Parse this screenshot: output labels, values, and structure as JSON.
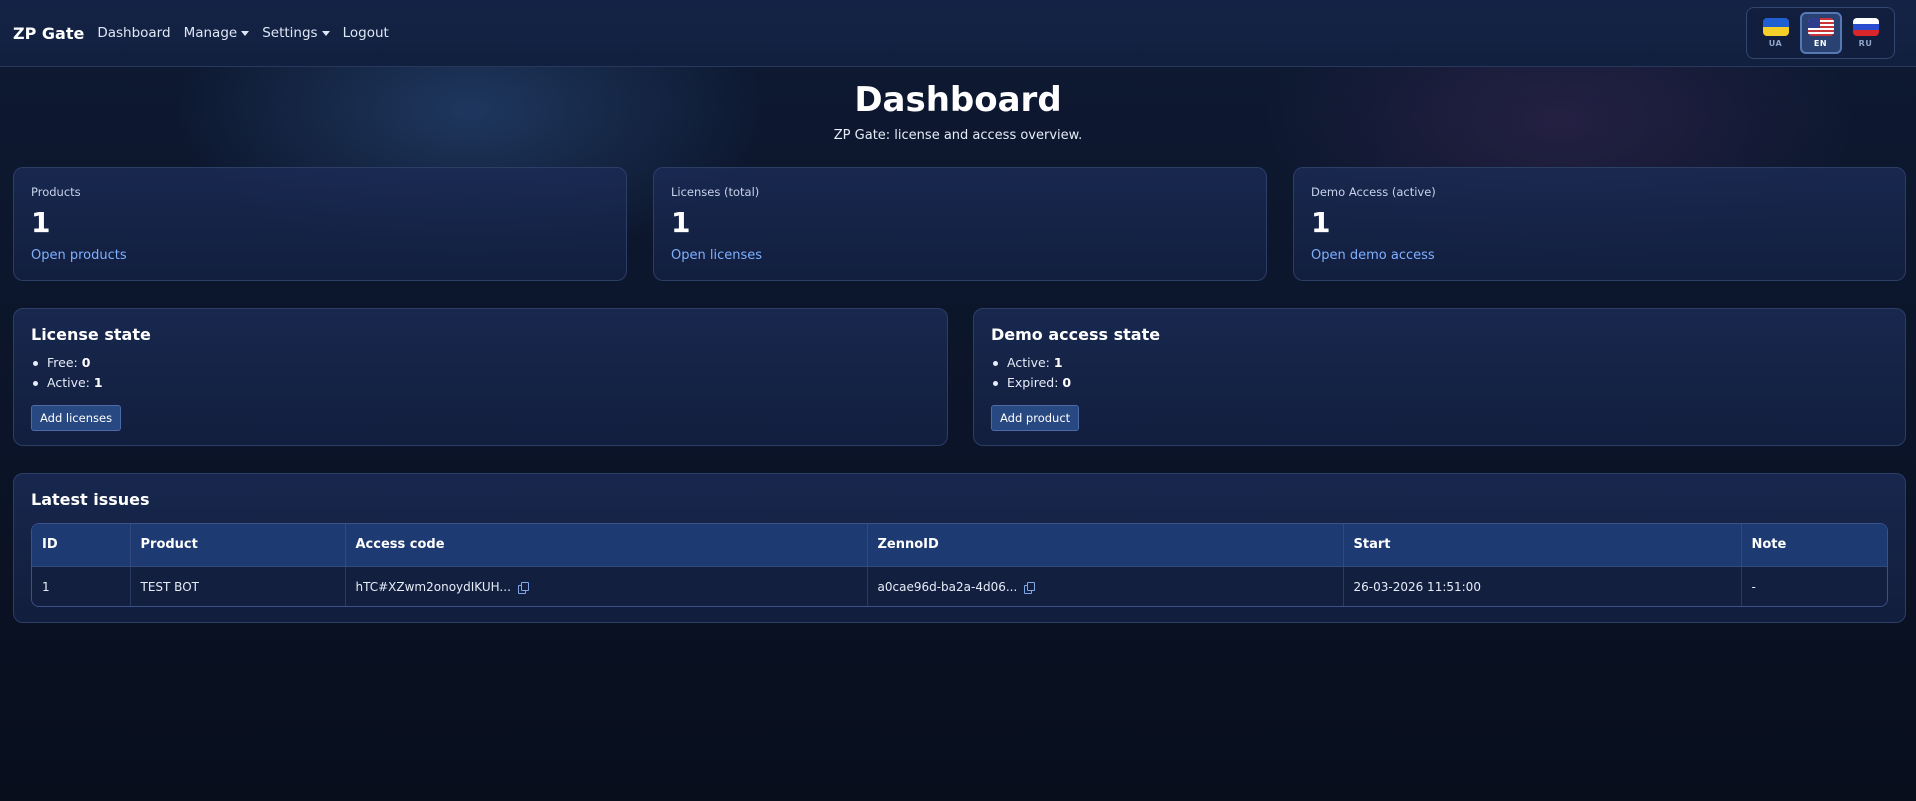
{
  "navbar": {
    "brand": "ZP Gate",
    "links": [
      {
        "label": "Dashboard"
      },
      {
        "label": "Manage"
      },
      {
        "label": "Settings"
      },
      {
        "label": "Logout"
      }
    ],
    "languages": [
      {
        "code": "UA",
        "flag": "ukraine-flag-icon",
        "active": false
      },
      {
        "code": "EN",
        "flag": "us-flag-icon",
        "active": true
      },
      {
        "code": "RU",
        "flag": "russia-flag-icon",
        "active": false
      }
    ]
  },
  "header": {
    "title": "Dashboard",
    "subtitle": "ZP Gate: license and access overview."
  },
  "stats": [
    {
      "label": "Products",
      "value": "1",
      "link": "Open products"
    },
    {
      "label": "Licenses (total)",
      "value": "1",
      "link": "Open licenses"
    },
    {
      "label": "Demo Access (active)",
      "value": "1",
      "link": "Open demo access"
    }
  ],
  "license_state": {
    "title": "License state",
    "items": [
      {
        "label": "Free:",
        "value": "0"
      },
      {
        "label": "Active:",
        "value": "1"
      }
    ],
    "button": "Add licenses"
  },
  "demo_state": {
    "title": "Demo access state",
    "items": [
      {
        "label": "Active:",
        "value": "1"
      },
      {
        "label": "Expired:",
        "value": "0"
      }
    ],
    "button": "Add product"
  },
  "latest_issues": {
    "title": "Latest issues",
    "columns": [
      "ID",
      "Product",
      "Access code",
      "ZennoID",
      "Start",
      "Note"
    ],
    "rows": [
      {
        "id": "1",
        "product": "TEST BOT",
        "access_code": "hTC#XZwm2onoydIKUH...",
        "zenno_id": "a0cae96d-ba2a-4d06...",
        "start": "26-03-2026 11:51:00",
        "note": "-"
      }
    ]
  },
  "colors": {
    "accent_link": "#7fb0ff",
    "button_bg": "#284882",
    "table_header": "#1e3a72"
  }
}
